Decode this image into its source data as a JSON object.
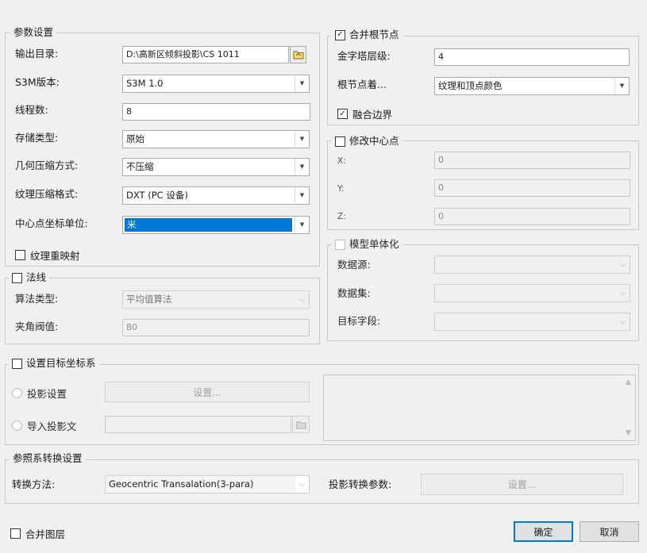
{
  "params": {
    "title": "参数设置",
    "output_dir_label": "输出目录:",
    "output_dir_value": "D:\\高新区倾斜投影\\CS 1011",
    "s3m_version_label": "S3M版本:",
    "s3m_version_value": "S3M 1.0",
    "threads_label": "线程数:",
    "threads_value": "8",
    "storage_type_label": "存储类型:",
    "storage_type_value": "原始",
    "geometry_compression_label": "几何压缩方式:",
    "geometry_compression_value": "不压缩",
    "texture_compression_label": "纹理压缩格式:",
    "texture_compression_value": "DXT (PC 设备)",
    "center_unit_label": "中心点坐标单位:",
    "center_unit_value": "米",
    "texture_remap_label": "纹理重映射"
  },
  "normals": {
    "title": "法线",
    "algorithm_label": "算法类型:",
    "algorithm_value": "平均值算法",
    "angle_label": "夹角阀值:",
    "angle_value": "80"
  },
  "merge_root": {
    "title": "合并根节点",
    "pyramid_label": "金字塔层级:",
    "pyramid_value": "4",
    "root_color_label": "根节点着...",
    "root_color_value": "纹理和顶点颜色",
    "merge_border_label": "融合边界"
  },
  "center_point": {
    "title": "修改中心点",
    "x_label": "X:",
    "x_value": "0",
    "y_label": "Y:",
    "y_value": "0",
    "z_label": "Z:",
    "z_value": "0"
  },
  "model_single": {
    "title": "模型单体化",
    "datasource_label": "数据源:",
    "dataset_label": "数据集:",
    "target_field_label": "目标字段:"
  },
  "target_crs": {
    "title": "设置目标坐标系",
    "projection_radio_label": "投影设置",
    "projection_button": "设置...",
    "import_radio_label": "导入投影文"
  },
  "transform": {
    "title": "参照系转换设置",
    "method_label": "转换方法:",
    "method_value": "Geocentric Transalation(3-para)",
    "params_label": "投影转换参数:",
    "params_button": "设置..."
  },
  "footer": {
    "merge_layers_label": "合并图层",
    "ok_button": "确定",
    "cancel_button": "取消"
  },
  "check_mark": "✓",
  "arrow_glyph": "▼",
  "chevron_glyph": "⌵",
  "colors": {
    "selection": "#0078d7",
    "background": "#f0f0f0"
  }
}
